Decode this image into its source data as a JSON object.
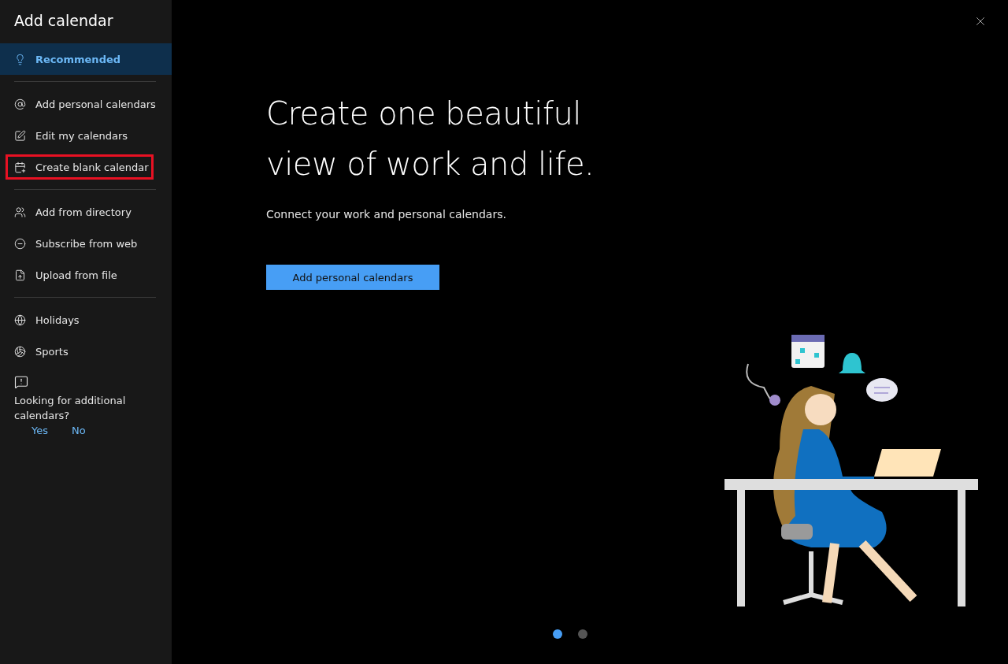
{
  "window": {
    "title": "Add calendar"
  },
  "sidebar": {
    "groups": [
      [
        {
          "label": "Recommended",
          "selected": true,
          "highlighted": false
        }
      ],
      [
        {
          "label": "Add personal calendars",
          "selected": false,
          "highlighted": false
        },
        {
          "label": "Edit my calendars",
          "selected": false,
          "highlighted": false
        },
        {
          "label": "Create blank calendar",
          "selected": false,
          "highlighted": true
        }
      ],
      [
        {
          "label": "Add from directory",
          "selected": false,
          "highlighted": false
        },
        {
          "label": "Subscribe from web",
          "selected": false,
          "highlighted": false
        },
        {
          "label": "Upload from file",
          "selected": false,
          "highlighted": false
        }
      ],
      [
        {
          "label": "Holidays",
          "selected": false,
          "highlighted": false
        },
        {
          "label": "Sports",
          "selected": false,
          "highlighted": false
        }
      ]
    ],
    "feedback": {
      "question": "Looking for additional calendars?",
      "answers": [
        "Yes",
        "No"
      ]
    }
  },
  "hero": {
    "headline": [
      "Create one beautiful",
      "view of work and life."
    ],
    "subtitle": "Connect your work and personal calendars.",
    "button": "Add personal calendars"
  },
  "carousel": {
    "dots": [
      {
        "selected": true
      },
      {
        "selected": false
      }
    ]
  }
}
